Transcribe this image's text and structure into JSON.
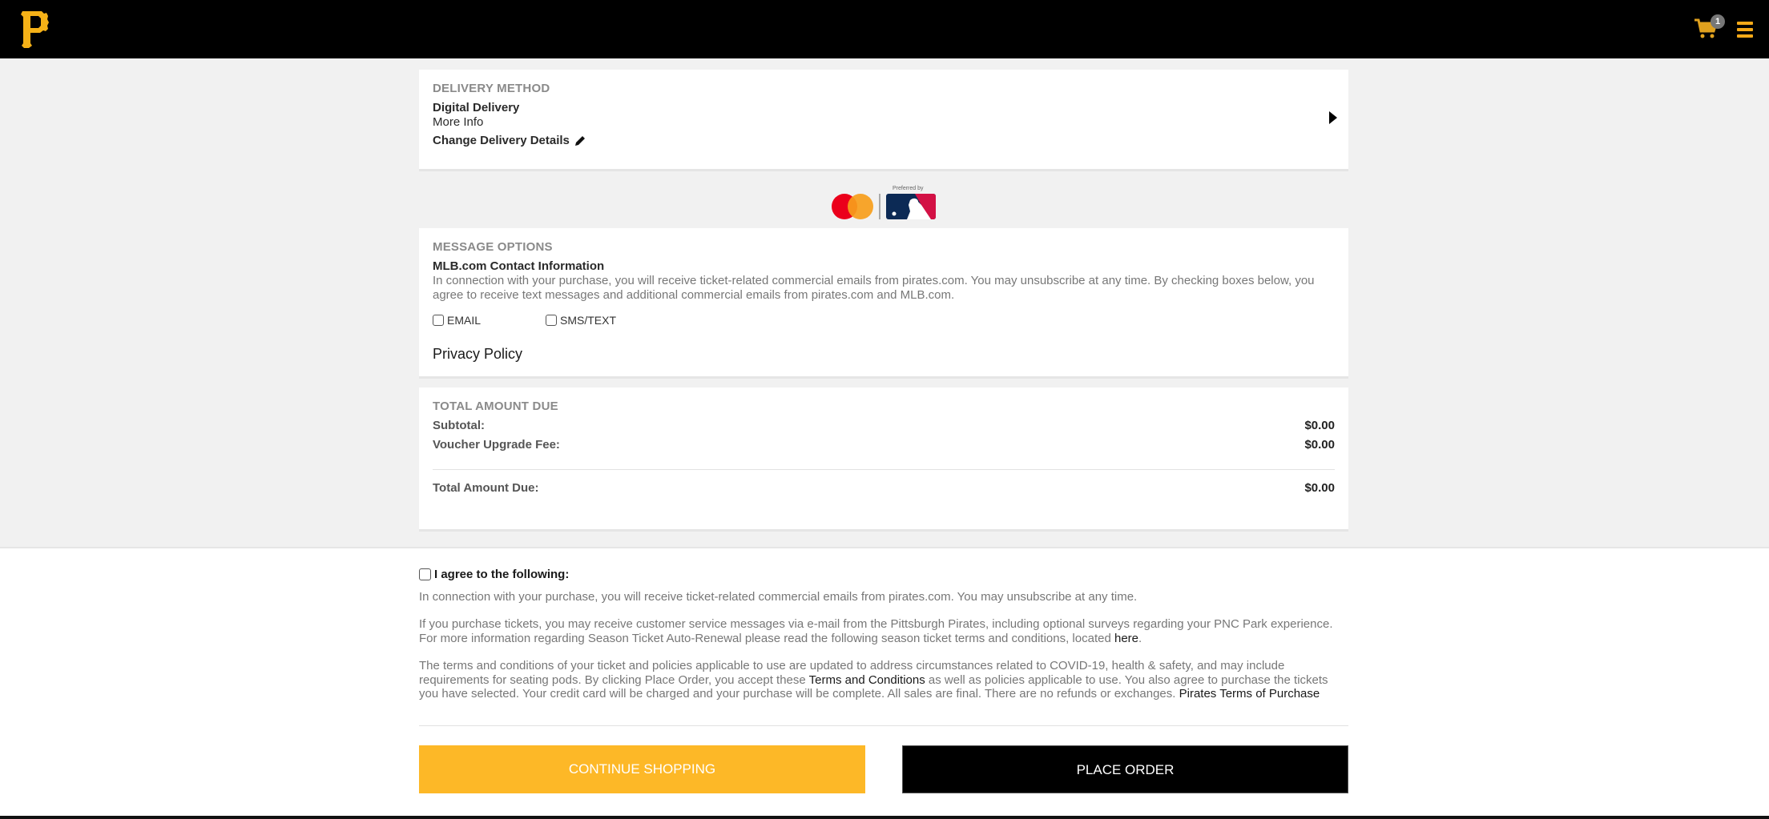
{
  "header": {
    "logo": "pirates-p-logo",
    "cart_count": "1"
  },
  "delivery": {
    "title": "DELIVERY METHOD",
    "method": "Digital Delivery",
    "more_info": "More Info",
    "change_details": "Change Delivery Details"
  },
  "sponsor": {
    "preferred_by": "Preferred by"
  },
  "message_options": {
    "title": "MESSAGE OPTIONS",
    "subtitle": "MLB.com Contact Information",
    "description": "In connection with your purchase, you will receive ticket-related commercial emails from pirates.com. You may unsubscribe at any time. By checking boxes below, you agree to receive text messages and additional commercial emails from pirates.com and MLB.com.",
    "checkboxes": [
      {
        "label": "EMAIL",
        "checked": false
      },
      {
        "label": "SMS/TEXT",
        "checked": false
      }
    ],
    "privacy_policy": "Privacy Policy"
  },
  "totals": {
    "title": "TOTAL AMOUNT DUE",
    "rows": [
      {
        "label": "Subtotal:",
        "value": "$0.00"
      },
      {
        "label": "Voucher Upgrade Fee:",
        "value": "$0.00"
      }
    ],
    "total": {
      "label": "Total Amount Due:",
      "value": "$0.00"
    }
  },
  "terms": {
    "agree_label": "I agree to the following:",
    "agree_checked": false,
    "p1": "In connection with your purchase, you will receive ticket-related commercial emails from pirates.com. You may unsubscribe at any time.",
    "p2_before": "If you purchase tickets, you may receive customer service messages via e-mail from the Pittsburgh Pirates, including optional surveys regarding your PNC Park experience. For more information regarding Season Ticket Auto-Renewal please read the following season ticket terms and conditions, located ",
    "p2_link": "here",
    "p2_after": ".",
    "p3_before": "The terms and conditions of your ticket and policies applicable to use are updated to address circumstances related to COVID-19, health & safety, and may include requirements for seating pods. By clicking Place Order, you accept these ",
    "p3_link1": "Terms and Conditions",
    "p3_middle": " as well as policies applicable to use. You also agree to purchase the tickets you have selected. Your credit card will be charged and your purchase will be complete. All sales are final. There are no refunds or exchanges. ",
    "p3_link2": "Pirates Terms of Purchase"
  },
  "actions": {
    "continue_shopping": "CONTINUE SHOPPING",
    "place_order": "PLACE ORDER"
  },
  "colors": {
    "brand_gold": "#fdb827",
    "header_bg": "#000000",
    "page_gray": "#f1f1f1"
  }
}
